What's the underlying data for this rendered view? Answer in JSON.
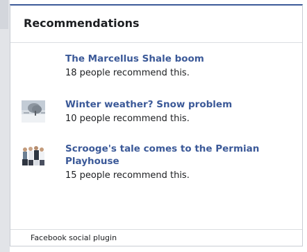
{
  "widget": {
    "title": "Recommendations",
    "accent_color": "#3b5998",
    "footer_label": "Facebook social plugin"
  },
  "items": [
    {
      "title": "The Marcellus Shale boom",
      "subtitle": "18 people recommend this.",
      "thumbnail": "none"
    },
    {
      "title": "Winter weather? Snow problem",
      "subtitle": "10 people recommend this.",
      "thumbnail": "snowy-tree-photo"
    },
    {
      "title": "Scrooge's tale comes to the Permian Playhouse",
      "subtitle": "15 people recommend this.",
      "thumbnail": "theater-cast-photo"
    }
  ]
}
